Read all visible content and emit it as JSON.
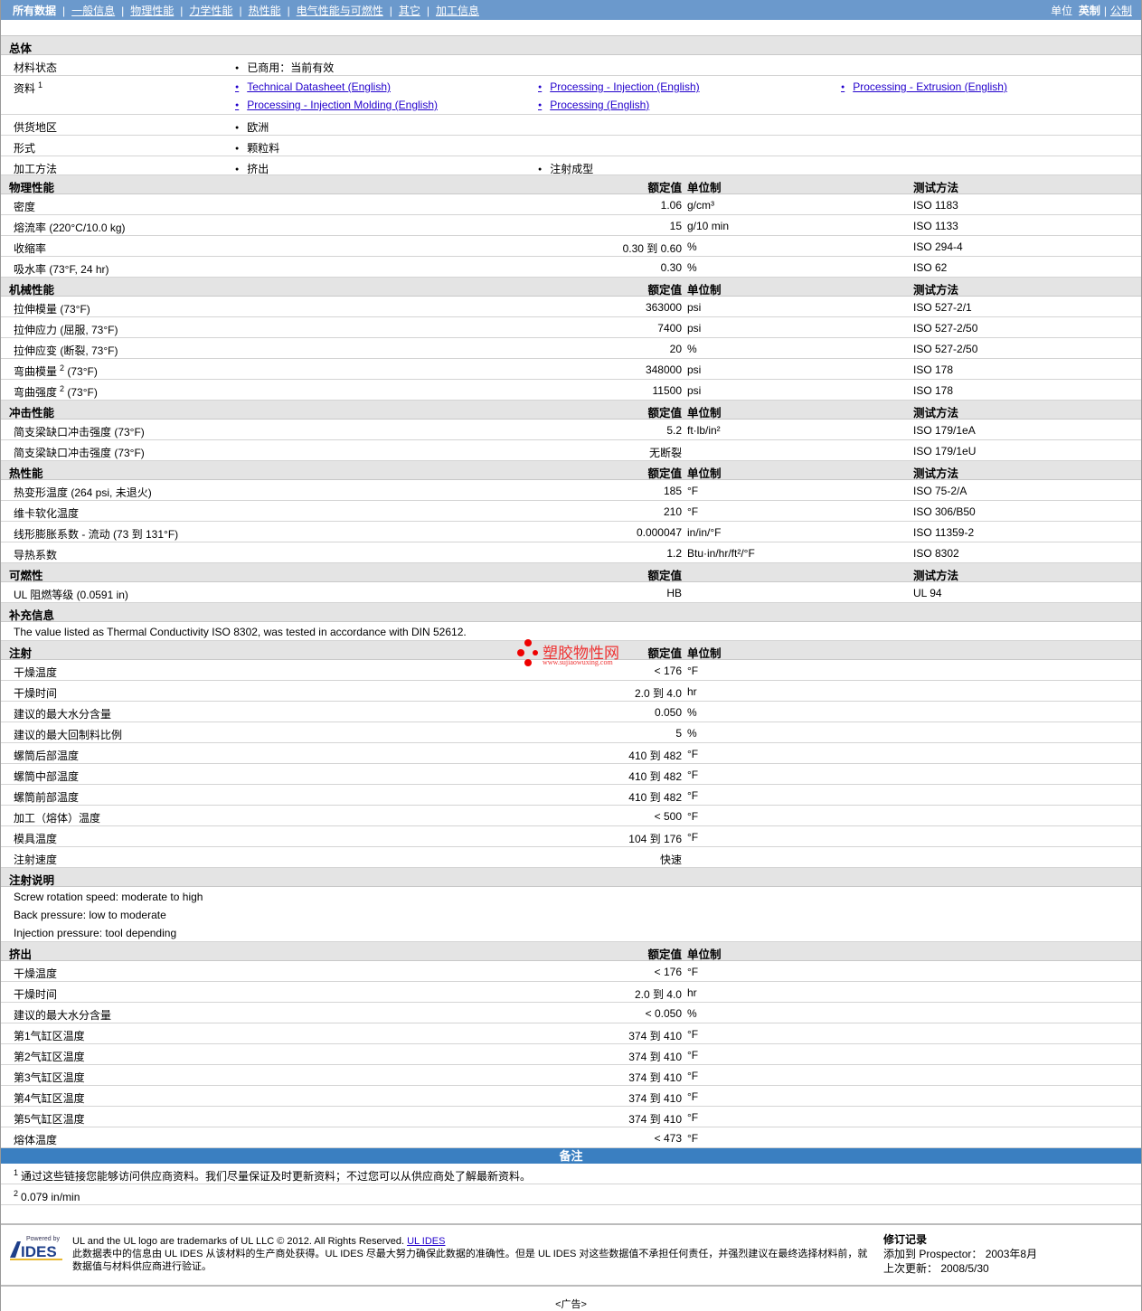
{
  "nav": {
    "items": [
      "所有数据",
      "一般信息",
      "物理性能",
      "力学性能",
      "热性能",
      "电气性能与可燃性",
      "其它",
      "加工信息"
    ],
    "units_label": "单位",
    "units_english": "英制",
    "units_metric": "公制"
  },
  "general": {
    "title": "总体",
    "status_label": "材料状态",
    "status_value": "已商用：当前有效",
    "docs_label": "资料",
    "docs_sup": "1",
    "docs": [
      "Technical Datasheet (English)",
      "Processing - Injection (English)",
      "Processing - Extrusion (English)",
      "Processing - Injection Molding (English)",
      "Processing (English)"
    ],
    "region_label": "供货地区",
    "region_value": "欧洲",
    "form_label": "形式",
    "form_value": "颗粒料",
    "method_label": "加工方法",
    "method_values": [
      "挤出",
      "注射成型"
    ]
  },
  "cols": {
    "value": "额定值",
    "unit": "单位制",
    "test": "测试方法"
  },
  "sections": [
    {
      "title": "物理性能",
      "unit_col": true,
      "test_col": true,
      "rows": [
        {
          "label": "密度",
          "value": "1.06",
          "unit": "g/cm³",
          "test": "ISO 1183"
        },
        {
          "label": "熔流率  (220°C/10.0 kg)",
          "value": "15",
          "unit": "g/10 min",
          "test": "ISO 1133"
        },
        {
          "label": "收缩率",
          "value": "0.30 到  0.60",
          "unit": "%",
          "test": "ISO 294-4"
        },
        {
          "label": "吸水率  (73°F, 24 hr)",
          "value": "0.30",
          "unit": "%",
          "test": "ISO 62"
        }
      ]
    },
    {
      "title": "机械性能",
      "unit_col": true,
      "test_col": true,
      "rows": [
        {
          "label": "拉伸模量  (73°F)",
          "value": "363000",
          "unit": "psi",
          "test": "ISO 527-2/1"
        },
        {
          "label": "拉伸应力  (屈服, 73°F)",
          "value": "7400",
          "unit": "psi",
          "test": "ISO 527-2/50"
        },
        {
          "label": "拉伸应变  (断裂, 73°F)",
          "value": "20",
          "unit": "%",
          "test": "ISO 527-2/50"
        },
        {
          "label": "弯曲模量",
          "sup": "2",
          "cond": " (73°F)",
          "value": "348000",
          "unit": "psi",
          "test": "ISO 178"
        },
        {
          "label": "弯曲强度",
          "sup": "2",
          "cond": " (73°F)",
          "value": "11500",
          "unit": "psi",
          "test": "ISO 178"
        }
      ]
    },
    {
      "title": "冲击性能",
      "unit_col": true,
      "test_col": true,
      "rows": [
        {
          "label": "简支梁缺口冲击强度  (73°F)",
          "value": "5.2",
          "unit": "ft·lb/in²",
          "test": "ISO 179/1eA"
        },
        {
          "label": "简支梁缺口冲击强度  (73°F)",
          "value": "无断裂",
          "unit": "",
          "test": "ISO 179/1eU"
        }
      ]
    },
    {
      "title": "热性能",
      "unit_col": true,
      "test_col": true,
      "rows": [
        {
          "label": "热变形温度  (264 psi, 未退火)",
          "value": "185",
          "unit": "°F",
          "test": "ISO 75-2/A"
        },
        {
          "label": "维卡软化温度",
          "value": "210",
          "unit": "°F",
          "test": "ISO 306/B50"
        },
        {
          "label": "线形膨胀系数  - 流动  (73 到  131°F)",
          "value": "0.000047",
          "unit": "in/in/°F",
          "test": "ISO 11359-2"
        },
        {
          "label": "导热系数",
          "value": "1.2",
          "unit": "Btu·in/hr/ft²/°F",
          "test": "ISO 8302"
        }
      ]
    },
    {
      "title": "可燃性",
      "unit_col": false,
      "test_col": true,
      "rows": [
        {
          "label": "UL 阻燃等级  (0.0591 in)",
          "value": "HB",
          "unit": "",
          "test": "UL 94"
        }
      ]
    },
    {
      "title": "补充信息",
      "notes": [
        "The value listed as Thermal Conductivity ISO 8302, was tested in accordance with DIN 52612."
      ]
    },
    {
      "title": "注射",
      "unit_col": true,
      "test_col": false,
      "rows": [
        {
          "label": "干燥温度",
          "value": "< 176",
          "unit": "°F"
        },
        {
          "label": "干燥时间",
          "value": "2.0 到  4.0",
          "unit": "hr"
        },
        {
          "label": "建议的最大水分含量",
          "value": "0.050",
          "unit": "%"
        },
        {
          "label": "建议的最大回制料比例",
          "value": "5",
          "unit": "%"
        },
        {
          "label": "螺筒后部温度",
          "value": "410 到  482",
          "unit": "°F"
        },
        {
          "label": "螺筒中部温度",
          "value": "410 到  482",
          "unit": "°F"
        },
        {
          "label": "螺筒前部温度",
          "value": "410 到  482",
          "unit": "°F"
        },
        {
          "label": "加工（熔体）温度",
          "value": "< 500",
          "unit": "°F"
        },
        {
          "label": "模具温度",
          "value": "104 到  176",
          "unit": "°F"
        },
        {
          "label": "注射速度",
          "value": "快速",
          "unit": ""
        }
      ]
    },
    {
      "title": "注射说明",
      "notes": [
        "Screw rotation speed: moderate to high",
        "Back pressure: low to moderate",
        "Injection pressure: tool depending"
      ]
    },
    {
      "title": "挤出",
      "unit_col": true,
      "test_col": false,
      "rows": [
        {
          "label": "干燥温度",
          "value": "< 176",
          "unit": "°F"
        },
        {
          "label": "干燥时间",
          "value": "2.0 到  4.0",
          "unit": "hr"
        },
        {
          "label": "建议的最大水分含量",
          "value": "< 0.050",
          "unit": "%"
        },
        {
          "label": "第1气缸区温度",
          "value": "374 到  410",
          "unit": "°F"
        },
        {
          "label": "第2气缸区温度",
          "value": "374 到  410",
          "unit": "°F"
        },
        {
          "label": "第3气缸区温度",
          "value": "374 到  410",
          "unit": "°F"
        },
        {
          "label": "第4气缸区温度",
          "value": "374 到  410",
          "unit": "°F"
        },
        {
          "label": "第5气缸区温度",
          "value": "374 到  410",
          "unit": "°F"
        },
        {
          "label": "熔体温度",
          "value": "< 473",
          "unit": "°F"
        }
      ]
    }
  ],
  "watermark": {
    "name": "塑胶物性网",
    "url": "www.sujiaowuxing.com"
  },
  "footnotes": {
    "title": "备注",
    "items": [
      {
        "n": "1",
        "text": "通过这些链接您能够访问供应商资料。我们尽量保证及时更新资料；不过您可以从供应商处了解最新资料。"
      },
      {
        "n": "2",
        "text": "0.079 in/min"
      }
    ]
  },
  "footer": {
    "powered": "Powered by",
    "logo": "IDES",
    "trademark": "UL and the UL logo are trademarks of UL LLC © 2012. All Rights Reserved.",
    "ul_link": "UL IDES",
    "disclaimer": "此数据表中的信息由  UL IDES 从该材料的生产商处获得。UL IDES 尽最大努力确保此数据的准确性。但是  UL IDES 对这些数据值不承担任何责任，并强烈建议在最终选择材料前，就数据值与材料供应商进行验证。",
    "rev_title": "修订记录",
    "added": "添加到  Prospector：  2003年8月",
    "updated": "上次更新：  2008/5/30",
    "ad": "<广告>"
  },
  "colors": {
    "nav": "#6b99cc",
    "bar": "#3a7fc1",
    "section": "#e4e4e4",
    "link": "#2200cc"
  }
}
